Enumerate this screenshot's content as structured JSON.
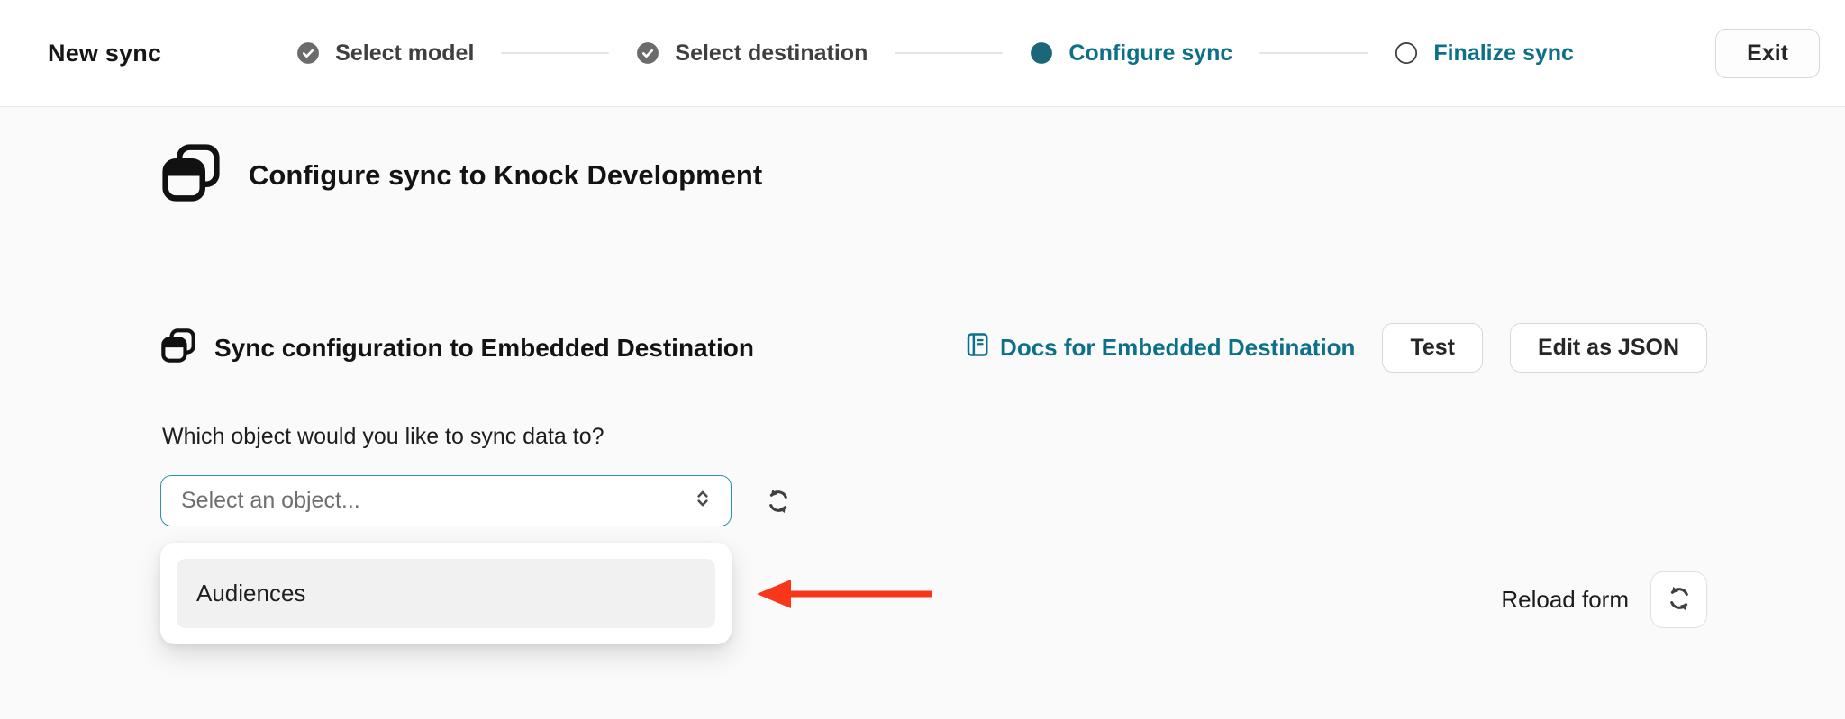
{
  "header": {
    "title": "New sync",
    "steps": [
      {
        "label": "Select model",
        "state": "complete"
      },
      {
        "label": "Select destination",
        "state": "complete"
      },
      {
        "label": "Configure sync",
        "state": "active"
      },
      {
        "label": "Finalize sync",
        "state": "upcoming"
      }
    ],
    "exit_label": "Exit"
  },
  "main": {
    "heading": "Configure sync to Knock Development",
    "section": {
      "title": "Sync configuration to Embedded Destination",
      "docs_link_label": "Docs for Embedded Destination",
      "test_button_label": "Test",
      "edit_json_button_label": "Edit as JSON"
    },
    "form": {
      "object_question": "Which object would you like to sync data to?",
      "object_placeholder": "Select an object...",
      "dropdown_options": [
        "Audiences"
      ]
    },
    "reload_form_label": "Reload form"
  },
  "icons": {
    "window-icon": "⧉",
    "check-circle-icon": "✓",
    "active-step-dot-icon": "●",
    "upcoming-step-circle-icon": "○",
    "book-icon": "📒",
    "chevron-up-down-icon": "⇅",
    "refresh-icon": "⟳",
    "arrow-left-icon": "←"
  },
  "colors": {
    "accent_teal_text": "#0C7089",
    "active_step_dot": "#1B6678",
    "select_border_teal": "#2D93A8",
    "annotation_arrow_red": "#F8361C",
    "page_bg": "#FAFAFA",
    "header_bg": "#FFFFFF",
    "header_border": "#E7E7E7",
    "option_bg": "#F1F1F1",
    "button_border": "#D8D8D8",
    "complete_step_gray": "#6B6B6B"
  }
}
